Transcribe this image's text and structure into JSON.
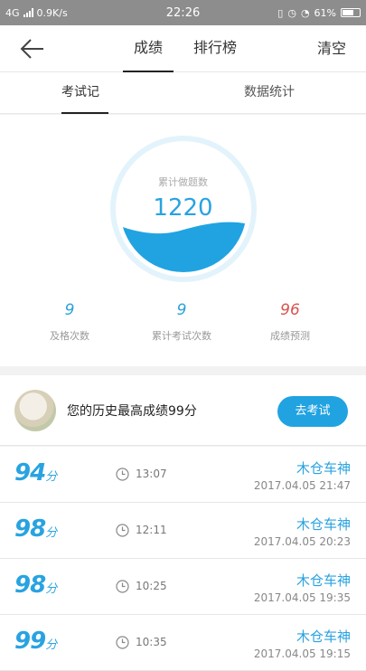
{
  "status": {
    "network": "4G",
    "speed": "0.9K/s",
    "time": "22:26",
    "battery": "61%"
  },
  "header": {
    "tabs": [
      "成绩",
      "排行榜"
    ],
    "active_tab": 0,
    "clear_label": "清空"
  },
  "subtabs": {
    "items": [
      "考试记录",
      "数据统计"
    ],
    "active": 0
  },
  "stats": {
    "gauge_label": "累计做题数",
    "gauge_value": "1220",
    "metrics": [
      {
        "value": "9",
        "label": "及格次数"
      },
      {
        "value": "9",
        "label": "累计考试次数"
      },
      {
        "value": "96",
        "label": "成绩预测"
      }
    ]
  },
  "best": {
    "text": "您的历史最高成绩99分",
    "button": "去考试"
  },
  "records": [
    {
      "score": "94",
      "unit": "分",
      "time": "13:07",
      "name": "木仓车神",
      "date": "2017.04.05  21:47"
    },
    {
      "score": "98",
      "unit": "分",
      "time": "12:11",
      "name": "木仓车神",
      "date": "2017.04.05  20:23"
    },
    {
      "score": "98",
      "unit": "分",
      "time": "10:25",
      "name": "木仓车神",
      "date": "2017.04.05  19:35"
    },
    {
      "score": "99",
      "unit": "分",
      "time": "10:35",
      "name": "木仓车神",
      "date": "2017.04.05  19:15"
    }
  ],
  "colors": {
    "accent": "#29a3e0",
    "button": "#21a3e1",
    "prediction": "#d9534f"
  }
}
